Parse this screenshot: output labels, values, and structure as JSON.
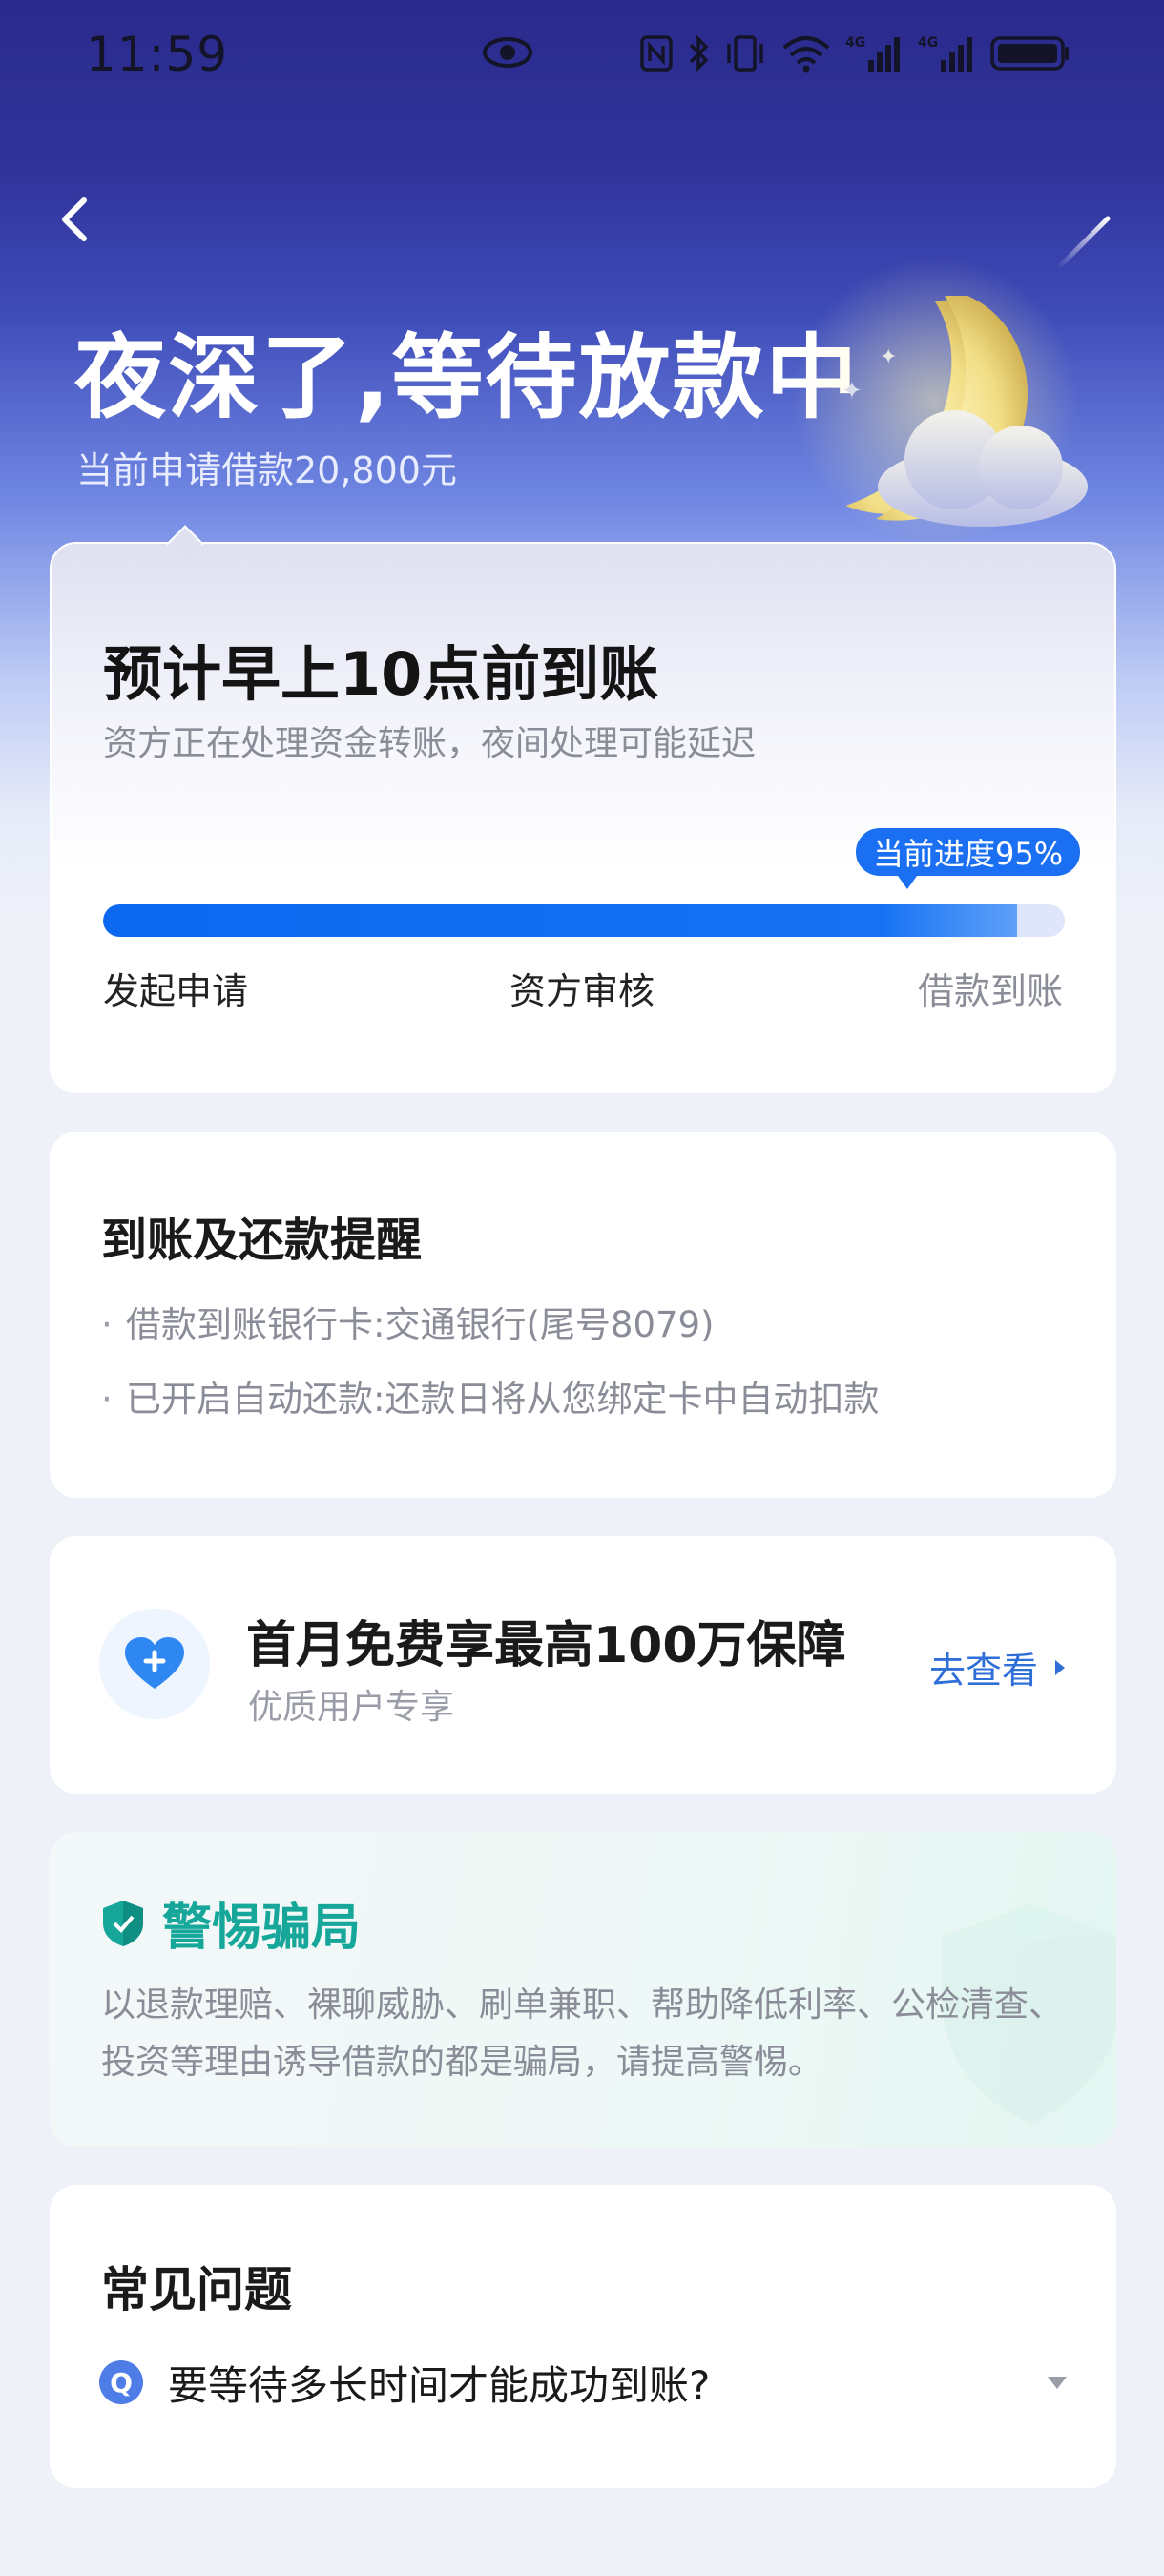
{
  "status_bar": {
    "time": "11:59",
    "icons": [
      "eye-icon",
      "nfc-icon",
      "bluetooth-icon",
      "vibrate-icon",
      "wifi-icon",
      "4g-signal-icon",
      "4g-signal-icon",
      "battery-icon"
    ]
  },
  "header": {
    "title": "夜深了,等待放款中",
    "subtitle": "当前申请借款20,800元"
  },
  "progress_card": {
    "eta": "预计早上10点前到账",
    "description": "资方正在处理资金转账，夜间处理可能延迟",
    "badge": "当前进度95%",
    "progress": 0.95,
    "steps": [
      "发起申请",
      "资方审核",
      "借款到账"
    ]
  },
  "reminder_card": {
    "title": "到账及还款提醒",
    "items": [
      "借款到账银行卡:交通银行(尾号8079)",
      "已开启自动还款:还款日将从您绑定卡中自动扣款"
    ]
  },
  "insurance_card": {
    "title": "首月免费享最高100万保障",
    "subtitle": "优质用户专享",
    "link": "去查看"
  },
  "warning_card": {
    "title": "警惕骗局",
    "text": "以退款理赔、裸聊威胁、刷单兼职、帮助降低利率、公检清查、投资等理由诱导借款的都是骗局，请提高警惕。"
  },
  "faq_card": {
    "title": "常见问题",
    "questions": [
      {
        "badge": "Q",
        "text": "要等待多长时间才能成功到账?"
      }
    ]
  },
  "colors": {
    "accent_blue": "#1a6ff2",
    "link_blue": "#2f6fd8",
    "warn_green": "#16a79a",
    "hero_top": "#2a2a8c"
  }
}
